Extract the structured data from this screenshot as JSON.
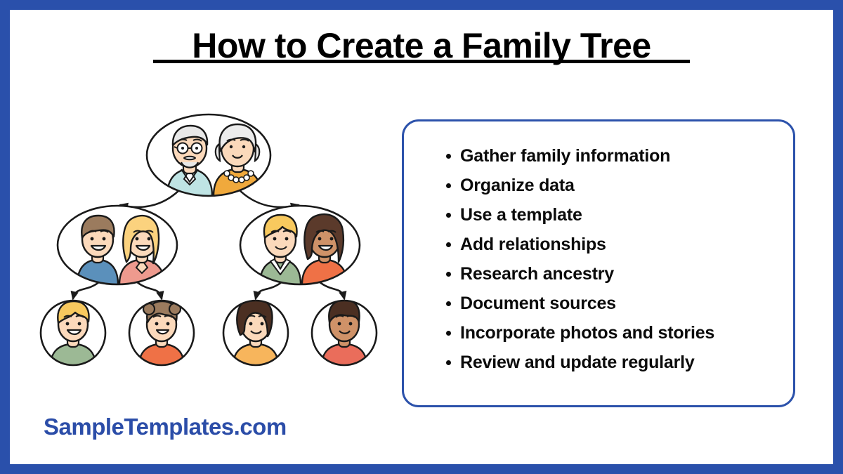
{
  "page": {
    "title": "How to Create a Family Tree",
    "frame_color": "#2a50ab",
    "background": "#ffffff"
  },
  "brand": {
    "label": "SampleTemplates.com",
    "color": "#2b4da8"
  },
  "steps_box": {
    "border_color": "#2c52ab",
    "items": [
      {
        "label": "Gather family information"
      },
      {
        "label": "Organize data"
      },
      {
        "label": "Use a template"
      },
      {
        "label": "Add relationships"
      },
      {
        "label": "Research ancestry"
      },
      {
        "label": "Document sources"
      },
      {
        "label": "Incorporate photos and stories"
      },
      {
        "label": "Review and update regularly"
      }
    ]
  },
  "illustration": {
    "name": "family-tree-diagram",
    "stroke_color": "#1a1a1a",
    "generations": [
      {
        "level": "grandparents",
        "shape": "ellipse",
        "people": [
          {
            "role": "grandfather",
            "hair": "#e8e8e8",
            "skin": "#fbd9bb",
            "top": "#bfe4e4",
            "accessory": "glasses"
          },
          {
            "role": "grandmother",
            "hair": "#ececec",
            "skin": "#fbd9bb",
            "top": "#f0a93c",
            "accessory": "pearl-necklace"
          }
        ]
      },
      {
        "level": "parents-left",
        "shape": "ellipse",
        "people": [
          {
            "role": "father",
            "hair": "#9b7b5e",
            "skin": "#fbd9bb",
            "top": "#5b90bb"
          },
          {
            "role": "mother",
            "hair": "#fbd27e",
            "skin": "#fbd9bb",
            "top": "#ee9a8e"
          }
        ]
      },
      {
        "level": "parents-right",
        "shape": "ellipse",
        "people": [
          {
            "role": "uncle",
            "hair": "#f8c95e",
            "skin": "#fbd9bb",
            "top": "#9cb995"
          },
          {
            "role": "aunt",
            "hair": "#5b3a2b",
            "skin": "#cf9268",
            "top": "#ef7146"
          }
        ]
      },
      {
        "level": "children",
        "shape": "circle",
        "people": [
          {
            "role": "child-1",
            "hair": "#f8c95e",
            "skin": "#fbd9bb",
            "top": "#9cb995"
          },
          {
            "role": "child-2",
            "hair": "#9b7b5e",
            "skin": "#fbd9bb",
            "top": "#ef7146"
          },
          {
            "role": "child-3",
            "hair": "#4b2f22",
            "skin": "#fbd9bb",
            "top": "#f5b košt"
          },
          {
            "role": "child-4",
            "hair": "#4b2f22",
            "skin": "#cf9268",
            "top": "#ea6d5b"
          }
        ]
      }
    ],
    "connectors": "curved-arrows"
  }
}
